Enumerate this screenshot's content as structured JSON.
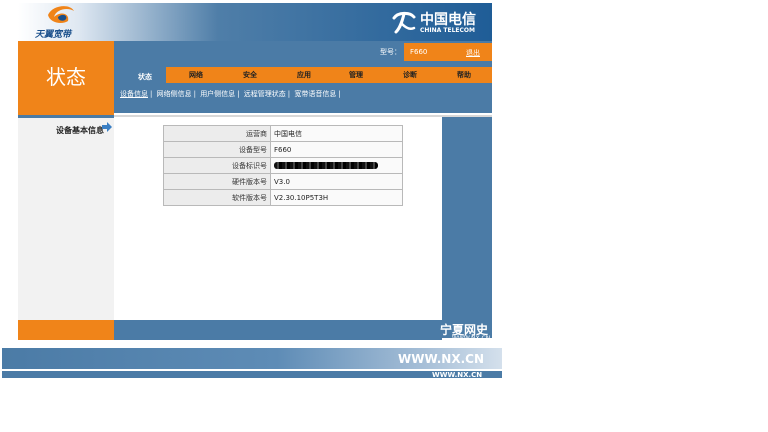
{
  "header": {
    "brand": "天翼宽带",
    "carrier_cn": "中国电信",
    "carrier_en": "CHINA TELECOM"
  },
  "left": {
    "section_title": "状态",
    "nav_label": "设备基本信息"
  },
  "topbar": {
    "model_label": "型号：",
    "model_value": "F660",
    "logout": "退出"
  },
  "menu": {
    "items": [
      "状态",
      "网络",
      "安全",
      "应用",
      "管理",
      "诊断",
      "帮助"
    ]
  },
  "submenu": {
    "items": [
      "设备信息",
      "网络侧信息",
      "用户侧信息",
      "远程管理状态",
      "宽带语音信息"
    ]
  },
  "device_info": {
    "rows": [
      {
        "label": "运营商",
        "value": "中国电信"
      },
      {
        "label": "设备型号",
        "value": "F660"
      },
      {
        "label": "设备标识号",
        "value": ""
      },
      {
        "label": "硬件版本号",
        "value": "V3.0"
      },
      {
        "label": "软件版本号",
        "value": "V2.30.10P5T3H"
      }
    ]
  },
  "watermark": {
    "cn": "宁夏网史",
    "url_small": "WWW.NX.CN"
  },
  "footer": {
    "url": "WWW.NX.CN",
    "url_small": "WWW.NX.CN"
  },
  "colors": {
    "orange": "#f08419",
    "blue": "#4b7ba6"
  }
}
